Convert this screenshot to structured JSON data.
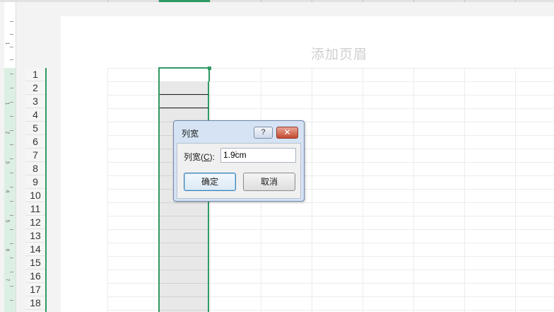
{
  "header": {
    "placeholder": "添加页眉"
  },
  "rows": [
    "1",
    "2",
    "3",
    "4",
    "5",
    "6",
    "7",
    "8",
    "9",
    "10",
    "11",
    "12",
    "13",
    "14",
    "15",
    "16",
    "17",
    "18"
  ],
  "ruler": [
    "1",
    "1",
    "2",
    "3",
    "4",
    "5",
    "6",
    "7"
  ],
  "dialog": {
    "title": "列宽",
    "help": "?",
    "close": "✕",
    "label": "列宽(",
    "label_key": "C",
    "label_tail": "):",
    "value": "1.9cm",
    "ok": "确定",
    "cancel": "取消"
  },
  "colors": {
    "accent": "#2f9a64",
    "dialog_frame": "#d5e3f4",
    "close_button": "#c24a30"
  }
}
